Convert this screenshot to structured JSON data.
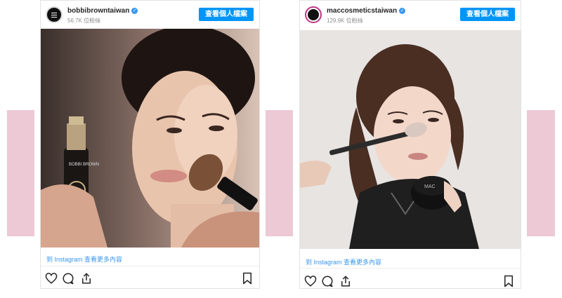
{
  "posts": [
    {
      "username": "bobbibrowntaiwan",
      "followers": "56.7K 位粉絲",
      "view_profile_label": "查看個人檔案",
      "more_link": "到 Instagram 查看更多內容",
      "bottle_brand": "BOBBI BROWN"
    },
    {
      "username": "maccosmeticstaiwan",
      "followers": "129.9K 位粉絲",
      "view_profile_label": "查看個人檔案",
      "more_link": "到 Instagram 查看更多內容",
      "compact_brand": "MAC"
    }
  ],
  "icons": [
    "heart-icon",
    "comment-icon",
    "share-icon",
    "bookmark-icon",
    "verified-icon"
  ],
  "colors": {
    "accent": "#0095f6",
    "link": "#3897f0",
    "pink_panel": "#ecc9d5"
  }
}
